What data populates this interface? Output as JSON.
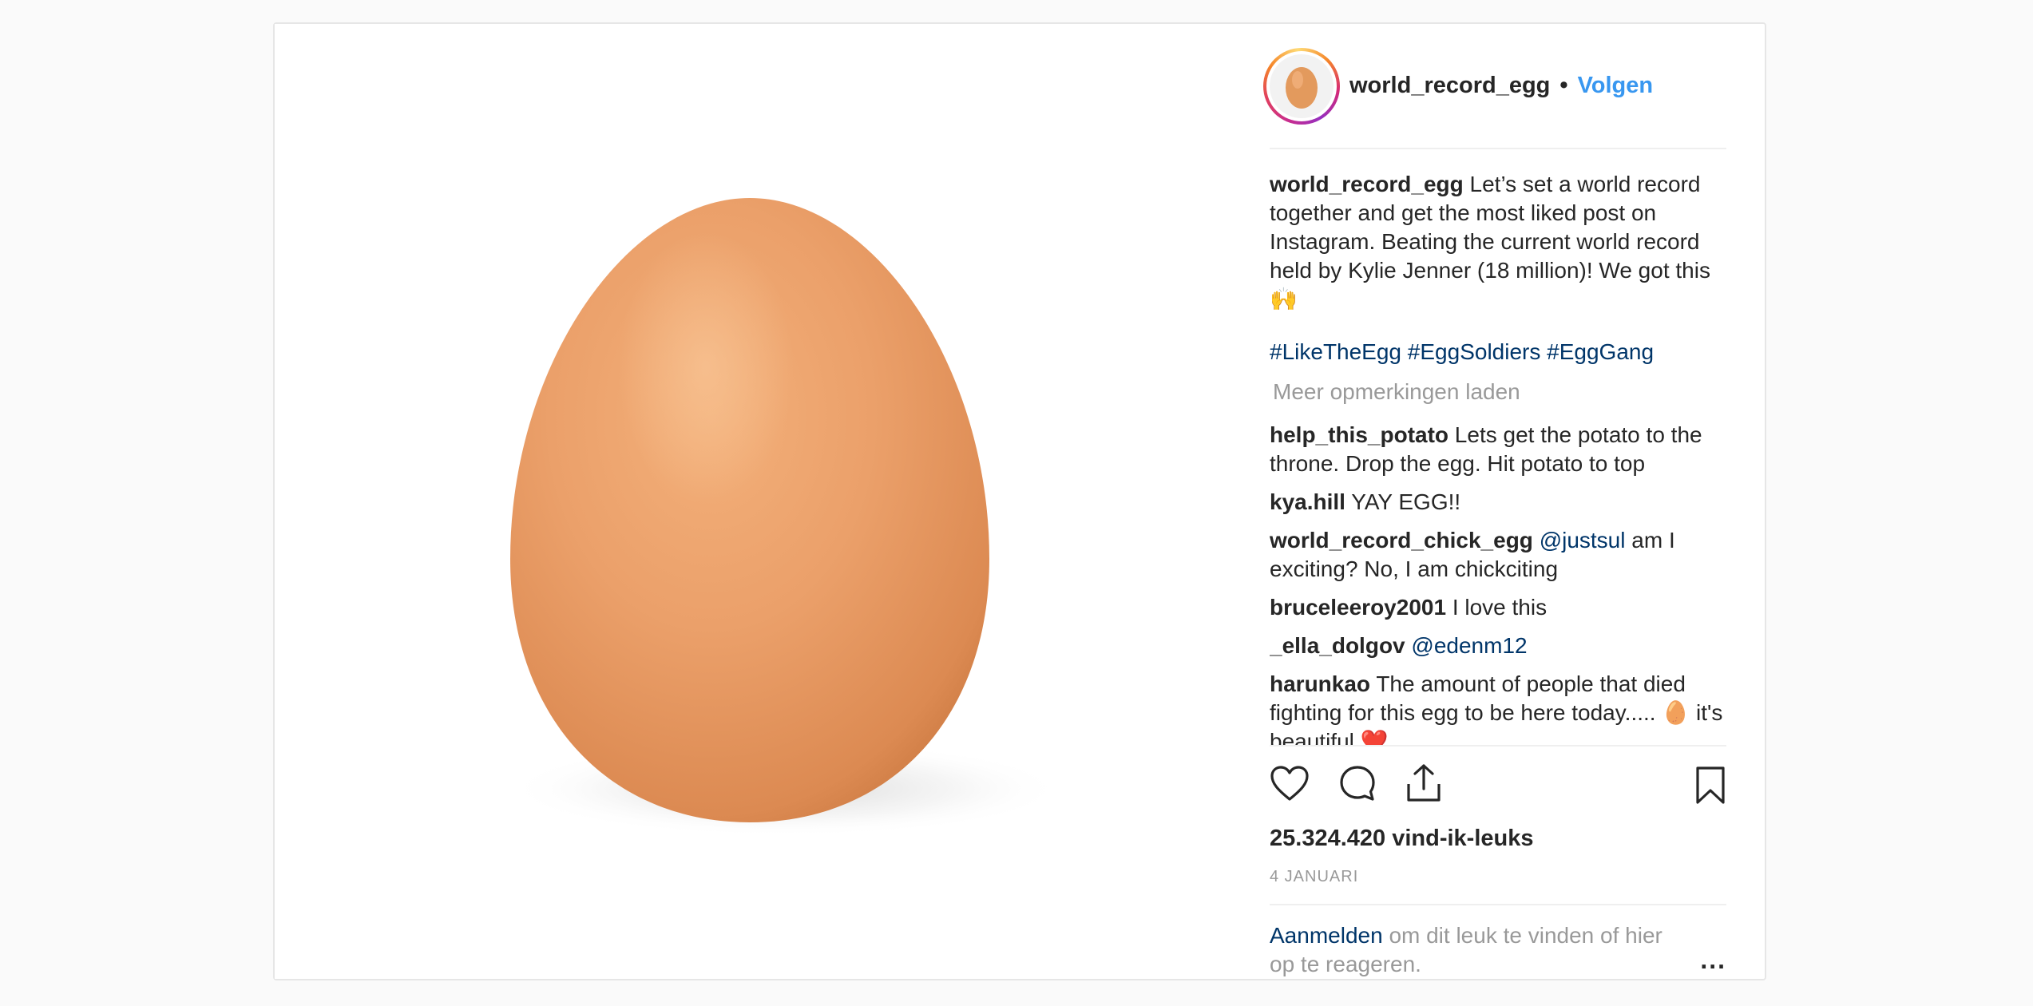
{
  "header": {
    "username": "world_record_egg",
    "separator": "•",
    "follow_label": "Volgen"
  },
  "caption": {
    "username": "world_record_egg",
    "text": "Let’s set a world record together and get the most liked post on Instagram. Beating the current world record held by Kylie Jenner (18 million)! We got this 🙌",
    "hashtags": [
      "#LikeTheEgg",
      "#EggSoldiers",
      "#EggGang"
    ]
  },
  "load_more_label": "Meer opmerkingen laden",
  "comments": [
    {
      "username": "help_this_potato",
      "mention": "",
      "text": "Lets get the potato to the throne. Drop the egg. Hit potato to top"
    },
    {
      "username": "kya.hill",
      "mention": "",
      "text": "YAY EGG!!"
    },
    {
      "username": "world_record_chick_egg",
      "mention": "@justsul",
      "text": "am I exciting? No, I am chickciting"
    },
    {
      "username": "bruceleeroy2001",
      "mention": "",
      "text": "I love this"
    },
    {
      "username": "_ella_dolgov",
      "mention": "@edenm12",
      "text": ""
    },
    {
      "username": "harunkao",
      "mention": "",
      "text": "The amount of people that died fighting for this egg to be here today..... 🥚 it's beautiful ❤️"
    }
  ],
  "likes": "25.324.420 vind-ik-leuks",
  "date": "4 JANUARI",
  "login": {
    "link": "Aanmelden",
    "text": "om dit leuk te vinden of hier op te reageren.",
    "more": "..."
  },
  "icons": {
    "like": "heart-icon",
    "comment": "comment-icon",
    "share": "share-icon",
    "save": "bookmark-icon"
  },
  "colors": {
    "link_blue": "#3897f0",
    "hashtag": "#003569",
    "muted": "#999999",
    "egg": "#e89d5f"
  }
}
